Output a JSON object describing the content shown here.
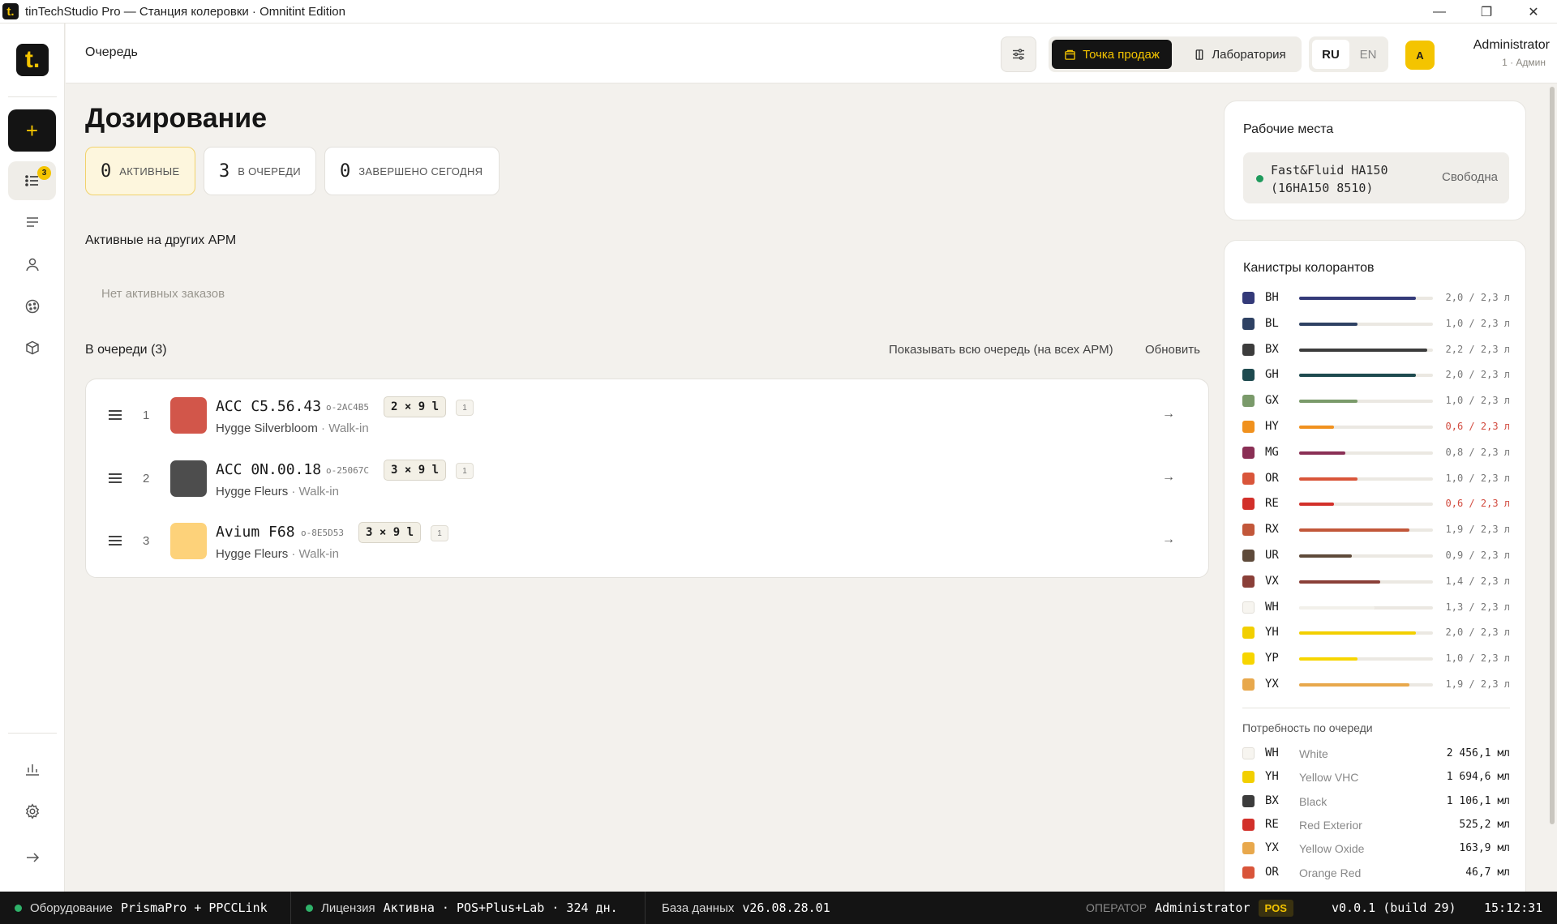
{
  "window": {
    "title": "tinTechStudio Pro — Станция колеровки · Omnitint Edition",
    "app_icon": "t."
  },
  "sidebar": {
    "logo": "t.",
    "new_label": "+",
    "queue_badge": "3"
  },
  "header": {
    "breadcrumb": "Очередь",
    "mode_pos": "Точка продаж",
    "mode_lab": "Лаборатория",
    "lang_ru": "RU",
    "lang_en": "EN",
    "avatar_letter": "A",
    "user_name": "Administrator",
    "user_role": "1 · Админ"
  },
  "main": {
    "title": "Дозирование",
    "stats": [
      {
        "num": "0",
        "label": "Активные"
      },
      {
        "num": "3",
        "label": "В очереди"
      },
      {
        "num": "0",
        "label": "Завершено сегодня"
      }
    ],
    "other_stations_title": "Активные на других АРМ",
    "empty_text": "Нет активных заказов",
    "queue_title": "В очереди (3)",
    "show_all": "Показывать всю очередь (на всех АРМ)",
    "refresh": "Обновить",
    "queue": [
      {
        "idx": "1",
        "color": "#d2564a",
        "code": "ACC C5.56.43",
        "order_id": "o-2AC4B5",
        "qty": "2 × 9 l",
        "count": "1",
        "product": "Hygge Silverbloom",
        "channel": " · Walk-in"
      },
      {
        "idx": "2",
        "color": "#4d4d4d",
        "code": "ACC 0N.00.18",
        "order_id": "o-25067C",
        "qty": "3 × 9 l",
        "count": "1",
        "product": "Hygge Fleurs",
        "channel": " · Walk-in"
      },
      {
        "idx": "3",
        "color": "#fdd27a",
        "code": "Avium F68",
        "order_id": "o-8E5D53",
        "qty": "3 × 9 l",
        "count": "1",
        "product": "Hygge Fleurs",
        "channel": " · Walk-in"
      }
    ]
  },
  "workstations": {
    "title": "Рабочие места",
    "items": [
      {
        "name": "Fast&Fluid HA150 (16HA150 8510)",
        "status": "Свободна"
      }
    ]
  },
  "canisters": {
    "title": "Канистры колорантов",
    "items": [
      {
        "code": "BH",
        "color": "#343a79",
        "level": 2.0,
        "capacity": 2.3,
        "text": "2,0 / 2,3 л",
        "low": false
      },
      {
        "code": "BL",
        "color": "#2e4163",
        "level": 1.0,
        "capacity": 2.3,
        "text": "1,0 / 2,3 л",
        "low": false
      },
      {
        "code": "BX",
        "color": "#3c3c3c",
        "level": 2.2,
        "capacity": 2.3,
        "text": "2,2 / 2,3 л",
        "low": false
      },
      {
        "code": "GH",
        "color": "#1e4a4f",
        "level": 2.0,
        "capacity": 2.3,
        "text": "2,0 / 2,3 л",
        "low": false
      },
      {
        "code": "GX",
        "color": "#7a9a6a",
        "level": 1.0,
        "capacity": 2.3,
        "text": "1,0 / 2,3 л",
        "low": false
      },
      {
        "code": "HY",
        "color": "#f0911e",
        "level": 0.6,
        "capacity": 2.3,
        "text": "0,6 / 2,3 л",
        "low": true
      },
      {
        "code": "MG",
        "color": "#8a2f55",
        "level": 0.8,
        "capacity": 2.3,
        "text": "0,8 / 2,3 л",
        "low": false
      },
      {
        "code": "OR",
        "color": "#d9553a",
        "level": 1.0,
        "capacity": 2.3,
        "text": "1,0 / 2,3 л",
        "low": false
      },
      {
        "code": "RE",
        "color": "#d2302a",
        "level": 0.6,
        "capacity": 2.3,
        "text": "0,6 / 2,3 л",
        "low": true
      },
      {
        "code": "RX",
        "color": "#c2573a",
        "level": 1.9,
        "capacity": 2.3,
        "text": "1,9 / 2,3 л",
        "low": false
      },
      {
        "code": "UR",
        "color": "#5e4a3a",
        "level": 0.9,
        "capacity": 2.3,
        "text": "0,9 / 2,3 л",
        "low": false
      },
      {
        "code": "VX",
        "color": "#8a3f38",
        "level": 1.4,
        "capacity": 2.3,
        "text": "1,4 / 2,3 л",
        "low": false
      },
      {
        "code": "WH",
        "color": "#f7f5f0",
        "level": 1.3,
        "capacity": 2.3,
        "text": "1,3 / 2,3 л",
        "low": false
      },
      {
        "code": "YH",
        "color": "#f2cf00",
        "level": 2.0,
        "capacity": 2.3,
        "text": "2,0 / 2,3 л",
        "low": false
      },
      {
        "code": "YP",
        "color": "#f7d500",
        "level": 1.0,
        "capacity": 2.3,
        "text": "1,0 / 2,3 л",
        "low": false
      },
      {
        "code": "YX",
        "color": "#e8a84c",
        "level": 1.9,
        "capacity": 2.3,
        "text": "1,9 / 2,3 л",
        "low": false
      }
    ]
  },
  "queue_needs": {
    "title": "Потребность по очереди",
    "items": [
      {
        "code": "WH",
        "color": "#f7f5f0",
        "name": "White",
        "amount": "2 456,1 мл"
      },
      {
        "code": "YH",
        "color": "#f2cf00",
        "name": "Yellow VHC",
        "amount": "1 694,6 мл"
      },
      {
        "code": "BX",
        "color": "#3c3c3c",
        "name": "Black",
        "amount": "1 106,1 мл"
      },
      {
        "code": "RE",
        "color": "#d2302a",
        "name": "Red Exterior",
        "amount": "525,2 мл"
      },
      {
        "code": "YX",
        "color": "#e8a84c",
        "name": "Yellow Oxide",
        "amount": "163,9 мл"
      },
      {
        "code": "OR",
        "color": "#d9553a",
        "name": "Orange Red",
        "amount": "46,7 мл"
      }
    ]
  },
  "statusbar": {
    "equipment_label": "Оборудование",
    "equipment_value": "PrismaPro + PPCCLink",
    "license_label": "Лицензия",
    "license_value": "Активна · POS+Plus+Lab · 324 дн.",
    "db_label": "База данных",
    "db_value": "v26.08.28.01",
    "operator_label": "ОПЕРАТОР",
    "operator_value": "Administrator",
    "mode_badge": "POS",
    "version": "v0.0.1 (build 29)",
    "time": "15:12:31"
  }
}
